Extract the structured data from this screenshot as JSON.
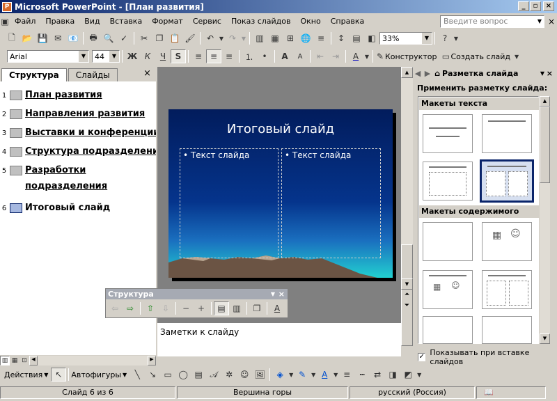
{
  "window": {
    "title": "Microsoft PowerPoint - [План развития]",
    "min": "_",
    "max": "▫",
    "close": "×"
  },
  "menu": [
    "Файл",
    "Правка",
    "Вид",
    "Вставка",
    "Формат",
    "Сервис",
    "Показ слайдов",
    "Окно",
    "Справка"
  ],
  "ask": {
    "placeholder": "Введите вопрос"
  },
  "toolbar": {
    "zoom": "33%"
  },
  "format": {
    "font": "Arial",
    "size": "44",
    "bold": "Ж",
    "italic": "К",
    "underline": "Ч",
    "shadow": "S",
    "designer": "Конструктор",
    "new_slide": "Создать слайд"
  },
  "tabs": {
    "outline": "Структура",
    "slides": "Слайды",
    "close": "×"
  },
  "outline": [
    {
      "num": "1",
      "text": "План развития"
    },
    {
      "num": "2",
      "text": "Направления развития"
    },
    {
      "num": "3",
      "text": "Выставки и конференции"
    },
    {
      "num": "4",
      "text": "Структура подразделения"
    },
    {
      "num": "5",
      "text": "Разработки подразделения"
    },
    {
      "num": "6",
      "text": "Итоговый слайд"
    }
  ],
  "slide": {
    "title": "Итоговый слайд",
    "left_text": "Текст слайда",
    "right_text": "Текст слайда"
  },
  "notes": "Заметки к слайду",
  "taskpane": {
    "title": "Разметка слайда",
    "apply": "Применить разметку слайда:",
    "text_layouts": "Макеты текста",
    "content_layouts": "Макеты содержимого",
    "show_on_insert": "Показывать при вставке слайдов"
  },
  "floatbar": {
    "title": "Структура"
  },
  "drawbar": {
    "actions": "Действия",
    "autoshapes": "Автофигуры"
  },
  "status": {
    "slide": "Слайд 6 из 6",
    "design": "Вершина горы",
    "lang": "русский (Россия)"
  }
}
